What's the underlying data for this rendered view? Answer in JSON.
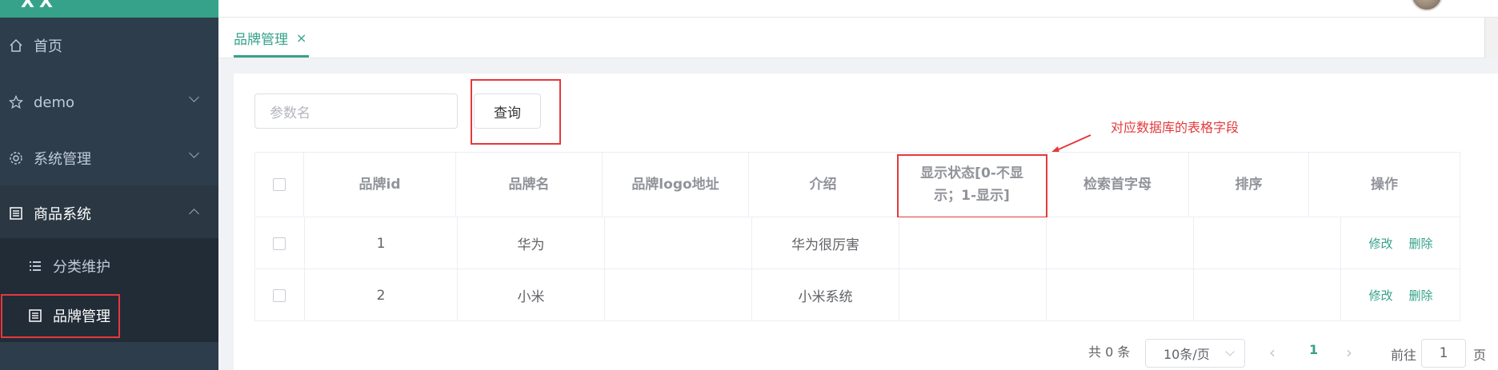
{
  "sidebar": {
    "brand": "XX",
    "items": [
      {
        "label": "首页",
        "icon": "home-icon"
      },
      {
        "label": "demo",
        "icon": "star-icon"
      },
      {
        "label": "系统管理",
        "icon": "gear-icon"
      },
      {
        "label": "商品系统",
        "icon": "document-icon"
      }
    ],
    "subitems": [
      {
        "label": "分类维护",
        "icon": "list-icon"
      },
      {
        "label": "品牌管理",
        "icon": "document-icon"
      }
    ]
  },
  "tabs": [
    {
      "label": "品牌管理",
      "close": "×"
    }
  ],
  "search": {
    "placeholder": "参数名",
    "button": "查询"
  },
  "annotation": "对应数据库的表格字段",
  "table": {
    "headers": [
      "品牌id",
      "品牌名",
      "品牌logo地址",
      "介绍",
      "显示状态[0-不显示；1-显示]",
      "检索首字母",
      "排序",
      "操作"
    ],
    "rows": [
      {
        "id": "1",
        "name": "华为",
        "logo": "",
        "intro": "华为很厉害",
        "status": "",
        "letter": "",
        "sort": "",
        "edit": "修改",
        "delete": "删除"
      },
      {
        "id": "2",
        "name": "小米",
        "logo": "",
        "intro": "小米系统",
        "status": "",
        "letter": "",
        "sort": "",
        "edit": "修改",
        "delete": "删除"
      }
    ]
  },
  "pagination": {
    "total": "共 0 条",
    "page_size": "10条/页",
    "current_page": "1",
    "goto_label": "前往",
    "goto_value": "1",
    "page_suffix": "页"
  },
  "colors": {
    "accent": "#36a28a",
    "sidebar": "#2e3d4b",
    "highlight": "#e4393c"
  }
}
